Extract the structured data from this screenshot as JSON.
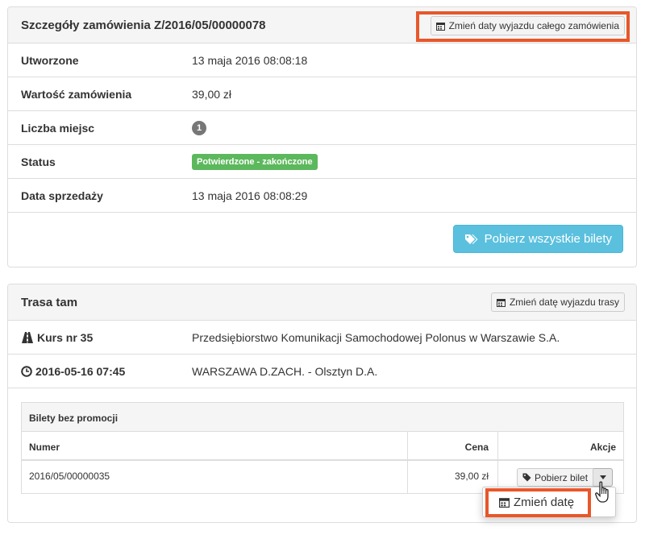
{
  "order_panel": {
    "title": "Szczegóły zamówienia Z/2016/05/00000078",
    "change_all_dates_label": "Zmień daty wyjazdu całego zamówienia",
    "rows": [
      {
        "label": "Utworzone",
        "value": "13 maja 2016 08:08:18"
      },
      {
        "label": "Wartość zamówienia",
        "value": "39,00 zł"
      },
      {
        "label": "Liczba miejsc",
        "value": "1"
      },
      {
        "label": "Status",
        "value": "Potwierdzone - zakończone"
      },
      {
        "label": "Data sprzedaży",
        "value": "13 maja 2016 08:08:29"
      }
    ],
    "download_all_label": "Pobierz wszystkie bilety"
  },
  "route_panel": {
    "title": "Trasa tam",
    "change_route_date_label": "Zmień datę wyjazdu trasy",
    "course_label": "Kurs nr 35",
    "course_value": "Przedsiębiorstwo Komunikacji Samochodowej Polonus w Warszawie S.A.",
    "datetime_label": "2016-05-16 07:45",
    "datetime_value": "WARSZAWA D.ZACH. - Olsztyn D.A."
  },
  "tickets": {
    "heading": "Bilety bez promocji",
    "columns": [
      "Numer",
      "Cena",
      "Akcje"
    ],
    "rows": [
      {
        "number": "2016/05/00000035",
        "price": "39,00 zł",
        "action": "Pobierz bilet"
      }
    ],
    "dropdown_item": "Zmień datę"
  },
  "colors": {
    "highlight": "#e8572a",
    "info_button": "#5bc0de",
    "success_label": "#5cb85c",
    "badge": "#777777"
  },
  "icons": [
    "calendar-icon",
    "tags-icon",
    "road-icon",
    "clock-icon",
    "tag-icon",
    "caret-down-icon",
    "hand-pointer-icon"
  ]
}
